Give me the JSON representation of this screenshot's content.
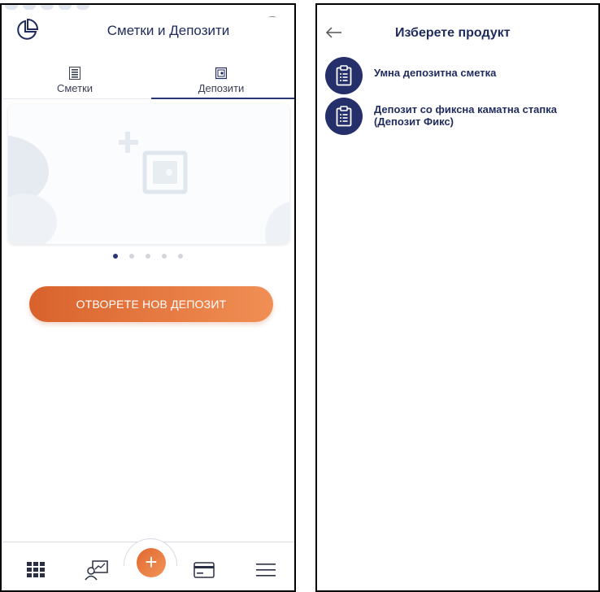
{
  "left_screen": {
    "title": "Сметки и Депозити",
    "tabs": [
      {
        "label": "Сметки",
        "icon": "list-icon",
        "active": false
      },
      {
        "label": "Депозити",
        "icon": "safe-icon",
        "active": true
      }
    ],
    "carousel": {
      "total_dots": 5,
      "active_index": 0
    },
    "open_button_label": "ОТВОРЕТЕ НОВ ДЕПОЗИТ",
    "bottom_nav": [
      "grid-icon",
      "transfer-icon",
      "plus-icon",
      "card-icon",
      "menu-icon"
    ],
    "fab_label": "+"
  },
  "right_screen": {
    "title": "Изберете продукт",
    "products": [
      {
        "label": "Умна депозитна сметка",
        "icon": "clipboard-icon"
      },
      {
        "label": "Депозит со фиксна каматна стапка (Депозит Фикс)",
        "icon": "clipboard-icon"
      }
    ]
  },
  "colors": {
    "brand_navy": "#25306b",
    "accent_orange_start": "#d9622c",
    "accent_orange_end": "#f08f55"
  }
}
